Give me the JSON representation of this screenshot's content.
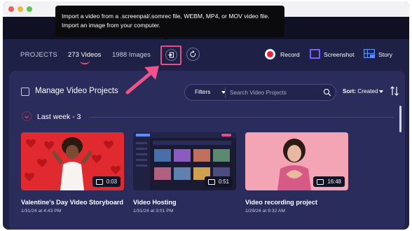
{
  "tooltip": {
    "line1": "Import a video from a .screenpal/.somrec file, WEBM, MP4, or MOV video file.",
    "line2": "Import an image from your computer."
  },
  "nav": {
    "projects": "PROJECTS",
    "videos": "273 Videos",
    "images": "1988 Images",
    "record": "Record",
    "screenshot": "Screenshot",
    "story": "Story"
  },
  "toolbar": {
    "manage_label": "Manage Video Projects",
    "filters_label": "Filters",
    "search_placeholder": "Search Video Projects",
    "sort_key": "Sort:",
    "sort_value": "Created"
  },
  "section": {
    "label": "Last week - 3"
  },
  "cards": [
    {
      "title": "Valentine's Day Video Storyboard",
      "date": "1/31/24 at 4:43 PM",
      "duration": "0:03"
    },
    {
      "title": "Video Hosting",
      "date": "1/31/24 at 3:01 PM",
      "duration": "0:51"
    },
    {
      "title": "Video recording project",
      "date": "1/29/24 at 9:32 AM",
      "duration": "16:48"
    }
  ],
  "colors": {
    "accent_pink": "#e94b86",
    "record_red": "#ec1f3f",
    "screenshot_purple": "#7d5cff",
    "panel_bg": "#2a2c5c"
  }
}
